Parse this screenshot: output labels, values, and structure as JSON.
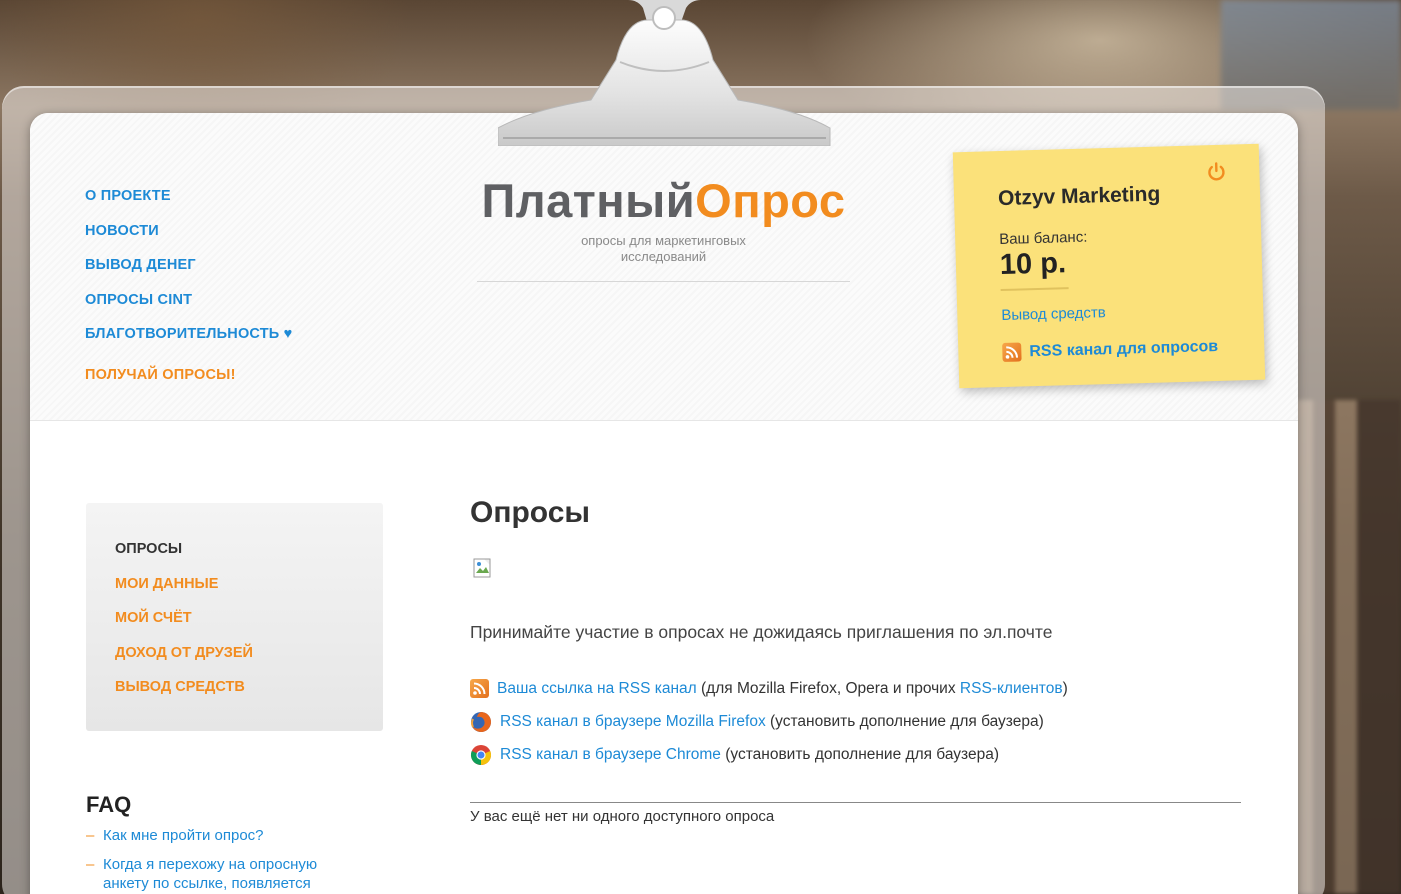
{
  "nav": {
    "items": [
      "О ПРОЕКТЕ",
      "НОВОСТИ",
      "ВЫВОД ДЕНЕГ",
      "ОПРОСЫ CINT",
      "БЛАГОТВОРИТЕЛЬНОСТЬ ♥"
    ],
    "cta": "ПОЛУЧАЙ ОПРОСЫ!"
  },
  "logo": {
    "part1": "Платный",
    "part2": "Опрос",
    "tagline_line1": "опросы для маркетинговых",
    "tagline_line2": "исследований"
  },
  "account": {
    "user": "Otzyv Marketing",
    "balance_label": "Ваш баланс:",
    "balance_value": "10 р.",
    "withdraw_link": "Вывод средств",
    "rss_link": "RSS канал для опросов"
  },
  "sidebar": {
    "items": [
      "ОПРОСЫ",
      "МОИ ДАННЫЕ",
      "МОЙ СЧЁТ",
      "ДОХОД ОТ ДРУЗЕЙ",
      "ВЫВОД СРЕДСТВ"
    ],
    "active_index": 0
  },
  "faq": {
    "title": "FAQ",
    "items": [
      "Как мне пройти опрос?",
      "Когда я перехожу на опросную анкету по ссылке, появляется"
    ]
  },
  "main": {
    "title": "Опросы",
    "intro": "Принимайте участие в опросах не дожидаясь приглашения по эл.почте",
    "links": [
      {
        "icon": "rss-icon",
        "link": "Ваша ссылка на RSS канал",
        "text1": " (для Mozilla Firefox, Opera и прочих ",
        "link2": "RSS-клиентов",
        "text2": ")"
      },
      {
        "icon": "firefox-icon",
        "link": "RSS канал в браузере Mozilla Firefox",
        "text1": " (установить дополнение для баузера)",
        "link2": "",
        "text2": ""
      },
      {
        "icon": "chrome-icon",
        "link": "RSS канал в браузере Chrome",
        "text1": " (установить дополнение для баузера)",
        "link2": "",
        "text2": ""
      }
    ],
    "empty_message": "У вас ещё нет ни одного доступного опроса"
  },
  "colors": {
    "link_blue": "#1d8ad6",
    "accent_orange": "#f28c1f",
    "sticky_yellow": "#fbe17a"
  }
}
